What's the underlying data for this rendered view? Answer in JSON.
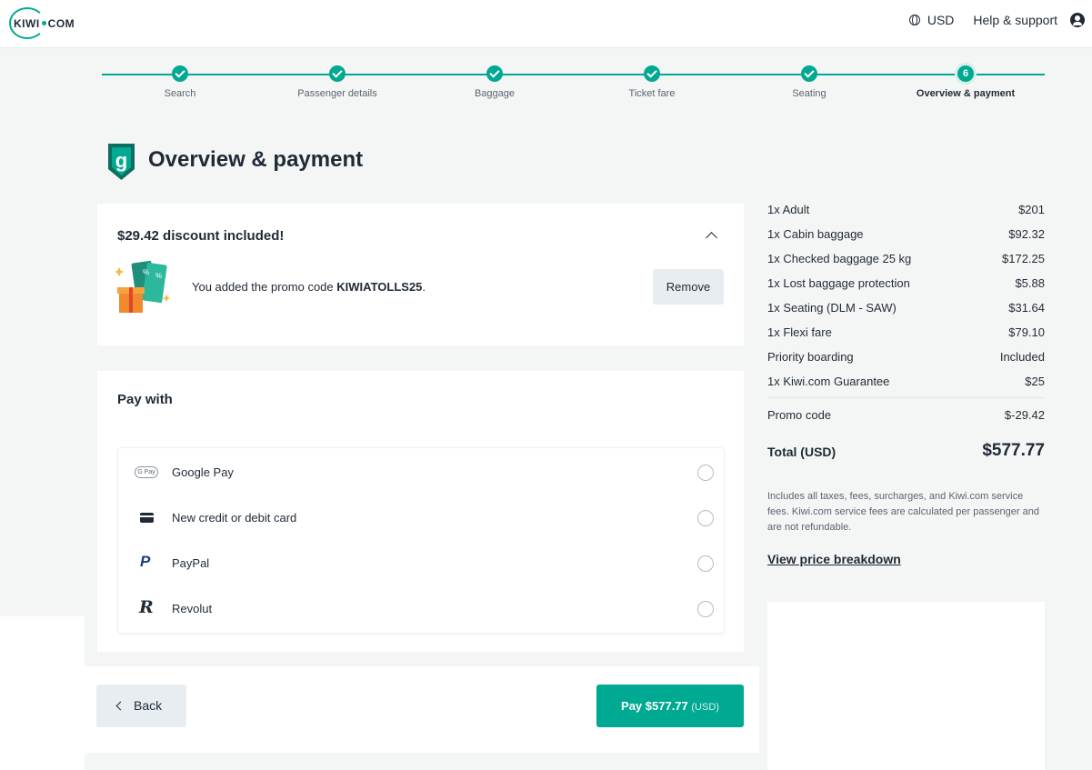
{
  "header": {
    "logo_text_left": "KIWI",
    "logo_text_right": "COM",
    "currency": "USD",
    "help": "Help & support",
    "icons": [
      "globe-icon",
      "account-icon"
    ]
  },
  "steps": [
    {
      "label": "Search",
      "state": "done"
    },
    {
      "label": "Passenger details",
      "state": "done"
    },
    {
      "label": "Baggage",
      "state": "done"
    },
    {
      "label": "Ticket fare",
      "state": "done"
    },
    {
      "label": "Seating",
      "state": "done"
    },
    {
      "label": "Overview & payment",
      "state": "active",
      "number": "6"
    }
  ],
  "page_title": "Overview & payment",
  "promo": {
    "title": "$29.42 discount included!",
    "text_before": "You added the promo code ",
    "code": "KIWIATOLLS25",
    "text_after": ".",
    "remove_label": "Remove"
  },
  "payment": {
    "title": "Pay with",
    "methods": [
      {
        "label": "Google Pay",
        "icon": "google-pay-icon",
        "icon_text": "G Pay"
      },
      {
        "label": "New credit or debit card",
        "icon": "credit-card-icon"
      },
      {
        "label": "PayPal",
        "icon": "paypal-icon",
        "icon_text": "P"
      },
      {
        "label": "Revolut",
        "icon": "revolut-icon",
        "icon_text": "R"
      }
    ]
  },
  "actions": {
    "back_label": "Back",
    "pay_label": "Pay $577.77",
    "pay_currency": "(USD)"
  },
  "summary": {
    "items": [
      {
        "label": "1x Adult",
        "value": "$201"
      },
      {
        "label": "1x Cabin baggage",
        "value": "$92.32"
      },
      {
        "label": "1x Checked baggage 25 kg",
        "value": "$172.25"
      },
      {
        "label": "1x Lost baggage protection",
        "value": "$5.88"
      },
      {
        "label": "1x Seating (DLM - SAW)",
        "value": "$31.64"
      },
      {
        "label": "1x Flexi fare",
        "value": "$79.10"
      },
      {
        "label": "Priority boarding",
        "value": "Included"
      },
      {
        "label": "1x Kiwi.com Guarantee",
        "value": "$25"
      }
    ],
    "promo_label": "Promo code",
    "promo_value": "$-29.42",
    "total_label": "Total (USD)",
    "total_value": "$577.77",
    "note": "Includes all taxes, fees, surcharges, and Kiwi.com service fees. Kiwi.com service fees are calculated per passenger and are not refundable.",
    "breakdown_link": "View price breakdown"
  },
  "colors": {
    "accent": "#00a991",
    "text": "#1f2a36",
    "muted": "#5a6470",
    "button_secondary": "#e8edf1"
  }
}
